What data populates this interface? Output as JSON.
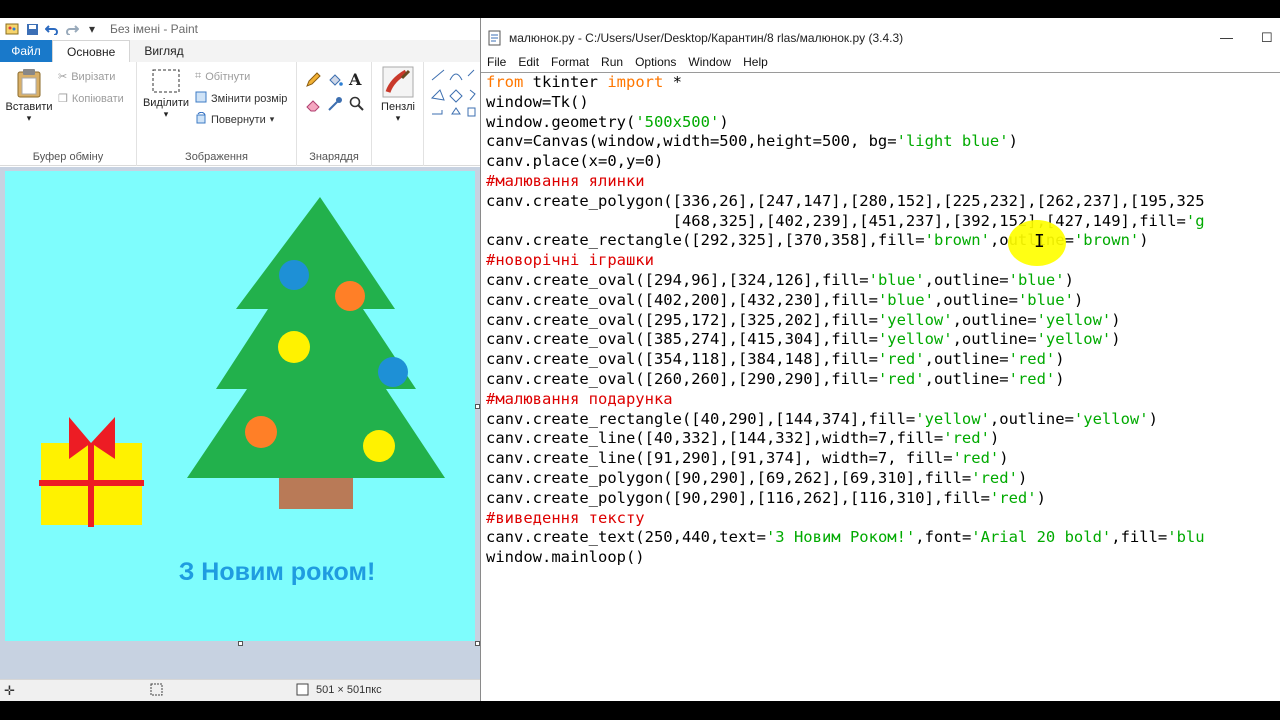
{
  "paint": {
    "title": "Без імені - Paint",
    "menu": {
      "file": "Файл",
      "home": "Основне",
      "view": "Вигляд"
    },
    "clipboard": {
      "paste": "Вставити",
      "cut": "Вирізати",
      "copy": "Копіювати",
      "label": "Буфер обміну"
    },
    "image": {
      "select": "Виділити",
      "crop": "Обітнути",
      "resize": "Змінити розмір",
      "rotate": "Повернути",
      "label": "Зображення"
    },
    "tools": {
      "label": "Знаряддя"
    },
    "brushes": {
      "label": "Пензлі"
    },
    "status": {
      "size": "501 × 501пкс"
    },
    "drawing": {
      "background": "#7efdfd",
      "greeting": "З Новим роком!",
      "tree_color": "#22b14c",
      "trunk_color": "#b97a57",
      "gift_color": "#fff200",
      "ribbon_color": "#ed1c24",
      "ornament_colors": [
        "#1e90d6",
        "#ff7f27",
        "#fff200",
        "#1e90d6",
        "#ff7f27",
        "#fff200"
      ]
    }
  },
  "idle": {
    "title": "малюнок.py - C:/Users/User/Desktop/Карантин/8 rlas/малюнок.py (3.4.3)",
    "menu": [
      "File",
      "Edit",
      "Format",
      "Run",
      "Options",
      "Window",
      "Help"
    ],
    "window_buttons": {
      "minimize": "—",
      "maximize": "☐"
    },
    "code": [
      [
        {
          "t": "kw",
          "s": "from"
        },
        {
          "t": "n",
          "s": " tkinter "
        },
        {
          "t": "kw",
          "s": "import"
        },
        {
          "t": "n",
          "s": " *"
        }
      ],
      [
        {
          "t": "n",
          "s": "window=Tk()"
        }
      ],
      [
        {
          "t": "n",
          "s": "window.geometry("
        },
        {
          "t": "st",
          "s": "'500x500'"
        },
        {
          "t": "n",
          "s": ")"
        }
      ],
      [
        {
          "t": "n",
          "s": "canv=Canvas(window,width=500,height=500, bg="
        },
        {
          "t": "st",
          "s": "'light blue'"
        },
        {
          "t": "n",
          "s": ")"
        }
      ],
      [
        {
          "t": "n",
          "s": "canv.place(x=0,y=0)"
        }
      ],
      [
        {
          "t": "cm",
          "s": "#малювання ялинки"
        }
      ],
      [
        {
          "t": "n",
          "s": "canv.create_polygon([336,26],[247,147],[280,152],[225,232],[262,237],[195,325"
        }
      ],
      [
        {
          "t": "n",
          "s": "                    [468,325],[402,239],[451,237],[392,152],[427,149],fill="
        },
        {
          "t": "st",
          "s": "'g"
        }
      ],
      [
        {
          "t": "n",
          "s": "canv.create_rectangle([292,325],[370,358],fill="
        },
        {
          "t": "st",
          "s": "'brown'"
        },
        {
          "t": "n",
          "s": ",outline="
        },
        {
          "t": "st",
          "s": "'brown'"
        },
        {
          "t": "n",
          "s": ")"
        }
      ],
      [
        {
          "t": "cm",
          "s": "#новорічні іграшки"
        }
      ],
      [
        {
          "t": "n",
          "s": "canv.create_oval([294,96],[324,126],fill="
        },
        {
          "t": "st",
          "s": "'blue'"
        },
        {
          "t": "n",
          "s": ",outline="
        },
        {
          "t": "st",
          "s": "'blue'"
        },
        {
          "t": "n",
          "s": ")"
        }
      ],
      [
        {
          "t": "n",
          "s": "canv.create_oval([402,200],[432,230],fill="
        },
        {
          "t": "st",
          "s": "'blue'"
        },
        {
          "t": "n",
          "s": ",outline="
        },
        {
          "t": "st",
          "s": "'blue'"
        },
        {
          "t": "n",
          "s": ")"
        }
      ],
      [
        {
          "t": "n",
          "s": "canv.create_oval([295,172],[325,202],fill="
        },
        {
          "t": "st",
          "s": "'yellow'"
        },
        {
          "t": "n",
          "s": ",outline="
        },
        {
          "t": "st",
          "s": "'yellow'"
        },
        {
          "t": "n",
          "s": ")"
        }
      ],
      [
        {
          "t": "n",
          "s": "canv.create_oval([385,274],[415,304],fill="
        },
        {
          "t": "st",
          "s": "'yellow'"
        },
        {
          "t": "n",
          "s": ",outline="
        },
        {
          "t": "st",
          "s": "'yellow'"
        },
        {
          "t": "n",
          "s": ")"
        }
      ],
      [
        {
          "t": "n",
          "s": "canv.create_oval([354,118],[384,148],fill="
        },
        {
          "t": "st",
          "s": "'red'"
        },
        {
          "t": "n",
          "s": ",outline="
        },
        {
          "t": "st",
          "s": "'red'"
        },
        {
          "t": "n",
          "s": ")"
        }
      ],
      [
        {
          "t": "n",
          "s": "canv.create_oval([260,260],[290,290],fill="
        },
        {
          "t": "st",
          "s": "'red'"
        },
        {
          "t": "n",
          "s": ",outline="
        },
        {
          "t": "st",
          "s": "'red'"
        },
        {
          "t": "n",
          "s": ")"
        }
      ],
      [
        {
          "t": "cm",
          "s": "#малювання подарунка"
        }
      ],
      [
        {
          "t": "n",
          "s": "canv.create_rectangle([40,290],[144,374],fill="
        },
        {
          "t": "st",
          "s": "'yellow'"
        },
        {
          "t": "n",
          "s": ",outline="
        },
        {
          "t": "st",
          "s": "'yellow'"
        },
        {
          "t": "n",
          "s": ")"
        }
      ],
      [
        {
          "t": "n",
          "s": "canv.create_line([40,332],[144,332],width=7,fill="
        },
        {
          "t": "st",
          "s": "'red'"
        },
        {
          "t": "n",
          "s": ")"
        }
      ],
      [
        {
          "t": "n",
          "s": "canv.create_line([91,290],[91,374], width=7, fill="
        },
        {
          "t": "st",
          "s": "'red'"
        },
        {
          "t": "n",
          "s": ")"
        }
      ],
      [
        {
          "t": "n",
          "s": "canv.create_polygon([90,290],[69,262],[69,310],fill="
        },
        {
          "t": "st",
          "s": "'red'"
        },
        {
          "t": "n",
          "s": ")"
        }
      ],
      [
        {
          "t": "n",
          "s": "canv.create_polygon([90,290],[116,262],[116,310],fill="
        },
        {
          "t": "st",
          "s": "'red'"
        },
        {
          "t": "n",
          "s": ")"
        }
      ],
      [
        {
          "t": "cm",
          "s": "#виведення тексту"
        }
      ],
      [
        {
          "t": "n",
          "s": "canv.create_text(250,440,text="
        },
        {
          "t": "st",
          "s": "'З Новим Роком!'"
        },
        {
          "t": "n",
          "s": ",font="
        },
        {
          "t": "st",
          "s": "'Arial 20 bold'"
        },
        {
          "t": "n",
          "s": ",fill="
        },
        {
          "t": "st",
          "s": "'blu"
        }
      ],
      [
        {
          "t": "n",
          "s": "window.mainloop()"
        }
      ]
    ]
  }
}
